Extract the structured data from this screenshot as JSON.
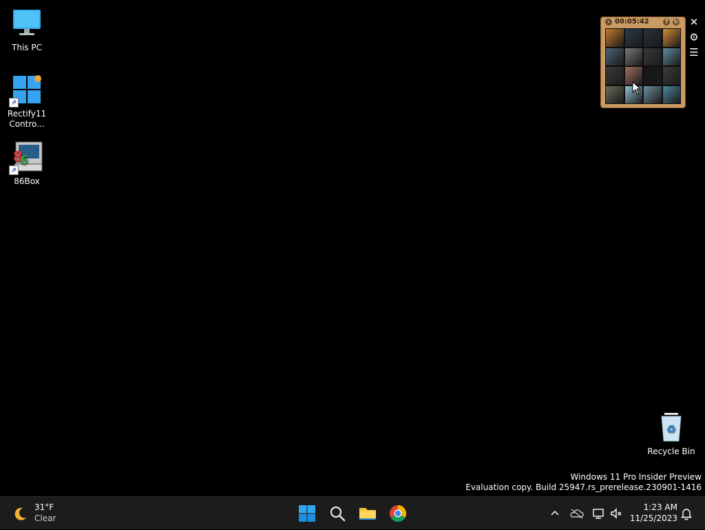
{
  "desktop_icons": [
    {
      "label": "This PC",
      "icon": "this-pc-icon"
    },
    {
      "label": "Rectify11\nContro...",
      "icon": "control-panel-icon"
    },
    {
      "label": "86Box",
      "icon": "86box-icon"
    },
    {
      "label": "Recycle Bin",
      "icon": "recycle-bin-icon"
    }
  ],
  "puzzle": {
    "timer": "00:05:42",
    "tiles": [
      "#c4792f",
      "#2a3a48",
      "#263238",
      "#d28a36",
      "#4c6478",
      "#7a7a7a",
      "#393939",
      "#5f8c9e",
      "#3b3b3b",
      "#a07060",
      "#151515",
      "#3c3c3c",
      "#6a6a5a",
      "#8fc3d0",
      "#6d8ea1",
      "#4a86a0"
    ]
  },
  "side_tools": {
    "close": "✕",
    "settings": "⚙",
    "menu": "☰"
  },
  "watermark": {
    "line1": "Windows 11 Pro Insider Preview",
    "line2": "Evaluation copy. Build 25947.rs_prerelease.230901-1416"
  },
  "taskbar": {
    "weather_temp": "31°F",
    "weather_cond": "Clear",
    "time": "1:23 AM",
    "date": "11/25/2023"
  },
  "colors": {
    "accent": "#0078d4",
    "taskbar_bg": "#1c1c1c"
  }
}
